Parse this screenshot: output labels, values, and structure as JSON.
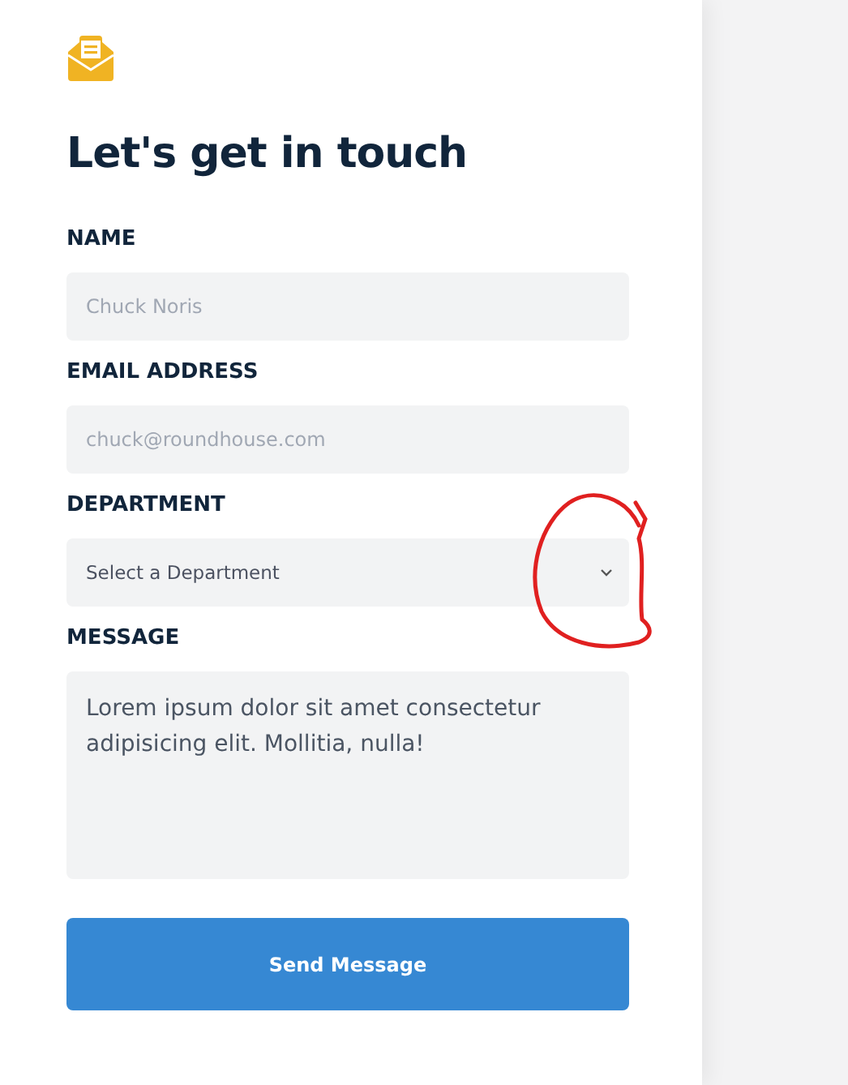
{
  "title": "Let's get in touch",
  "fields": [
    {
      "kind": "input",
      "label": "NAME",
      "placeholder": "Chuck Noris"
    },
    {
      "kind": "input",
      "label": "EMAIL ADDRESS",
      "placeholder": "chuck@roundhouse.com"
    },
    {
      "kind": "select",
      "label": "DEPARTMENT",
      "value": "Select a Department"
    },
    {
      "kind": "textarea",
      "label": "MESSAGE",
      "value": "Lorem ipsum dolor sit amet consectetur adipisicing elit. Mollitia, nulla!"
    }
  ],
  "submit": "Send Message"
}
